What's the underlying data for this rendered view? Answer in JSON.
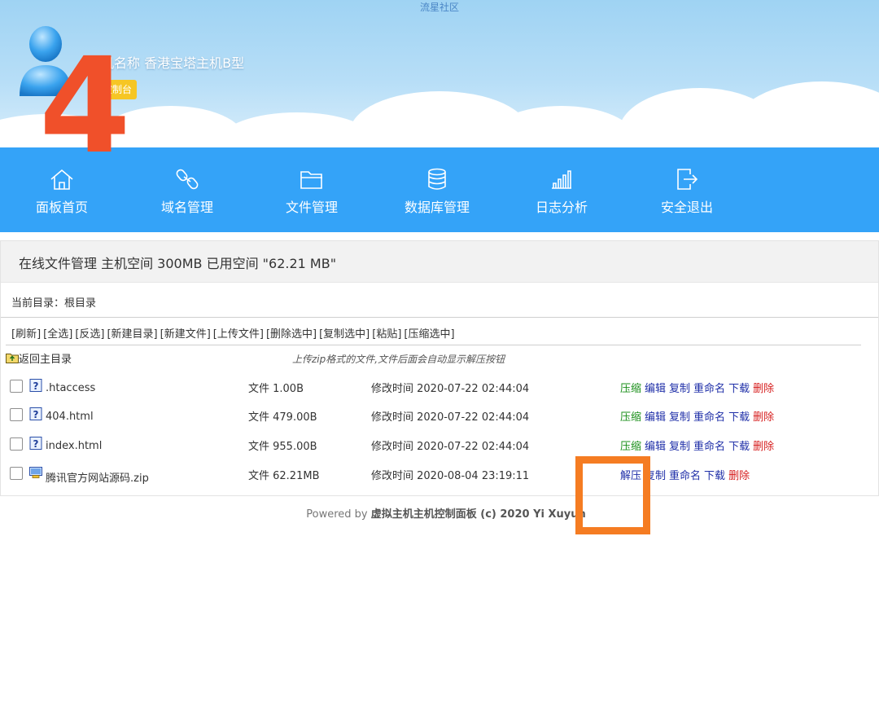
{
  "site_title": "流星社区",
  "host": {
    "name": "主机名称 香港宝塔主机B型",
    "badge": "机控制台"
  },
  "overlay_number": "4",
  "nav": [
    {
      "label": "面板首页",
      "icon": "home-icon"
    },
    {
      "label": "域名管理",
      "icon": "link-icon"
    },
    {
      "label": "文件管理",
      "icon": "folder-icon"
    },
    {
      "label": "数据库管理",
      "icon": "database-icon"
    },
    {
      "label": "日志分析",
      "icon": "bar-chart-icon"
    },
    {
      "label": "安全退出",
      "icon": "logout-icon"
    }
  ],
  "file_manager": {
    "title": "在线文件管理 主机空间 300MB 已用空间 \"62.21 MB\"",
    "current_dir": "当前目录：根目录",
    "toolbar": [
      "[刷新]",
      "[全选]",
      "[反选]",
      "[新建目录]",
      "[新建文件]",
      "[上传文件]",
      "[删除选中]",
      "[复制选中]",
      "[粘贴]",
      "[压缩选中]"
    ],
    "back_label": "返回主目录",
    "hint": "上传zip格式的文件,文件后面会自动显示解压按钮",
    "files": [
      {
        "name": ".htaccess",
        "size": "文件 1.00B",
        "modified": "修改时间 2020-07-22 02:44:04",
        "icon": "unknown-file-icon",
        "actions": [
          {
            "label": "压缩",
            "color": "green"
          },
          {
            "label": "编辑",
            "color": "blue"
          },
          {
            "label": "复制",
            "color": "blue"
          },
          {
            "label": "重命名",
            "color": "blue"
          },
          {
            "label": "下载",
            "color": "blue"
          },
          {
            "label": "删除",
            "color": "red"
          }
        ]
      },
      {
        "name": "404.html",
        "size": "文件 479.00B",
        "modified": "修改时间 2020-07-22 02:44:04",
        "icon": "unknown-file-icon",
        "actions": [
          {
            "label": "压缩",
            "color": "green"
          },
          {
            "label": "编辑",
            "color": "blue"
          },
          {
            "label": "复制",
            "color": "blue"
          },
          {
            "label": "重命名",
            "color": "blue"
          },
          {
            "label": "下载",
            "color": "blue"
          },
          {
            "label": "删除",
            "color": "red"
          }
        ]
      },
      {
        "name": "index.html",
        "size": "文件 955.00B",
        "modified": "修改时间 2020-07-22 02:44:04",
        "icon": "unknown-file-icon",
        "actions": [
          {
            "label": "压缩",
            "color": "green"
          },
          {
            "label": "编辑",
            "color": "blue"
          },
          {
            "label": "复制",
            "color": "blue"
          },
          {
            "label": "重命名",
            "color": "blue"
          },
          {
            "label": "下载",
            "color": "blue"
          },
          {
            "label": "删除",
            "color": "red"
          }
        ]
      },
      {
        "name": "腾讯官方网站源码.zip",
        "size": "文件 62.21MB",
        "modified": "修改时间 2020-08-04 23:19:11",
        "icon": "zip-file-icon",
        "actions": [
          {
            "label": "解压",
            "color": "blue"
          },
          {
            "label": "复制",
            "color": "blue"
          },
          {
            "label": "重命名",
            "color": "blue"
          },
          {
            "label": "下载",
            "color": "blue"
          },
          {
            "label": "删除",
            "color": "red"
          }
        ]
      }
    ]
  },
  "footer": {
    "prefix": "Powered by ",
    "product": "虚拟主机主机控制面板 (c) 2020 Yi Xuyun"
  },
  "colors": {
    "nav_bg": "#34a3f8",
    "badge": "#f6c624",
    "overlay_number": "#f0502a",
    "highlight_box": "#f57c22"
  }
}
